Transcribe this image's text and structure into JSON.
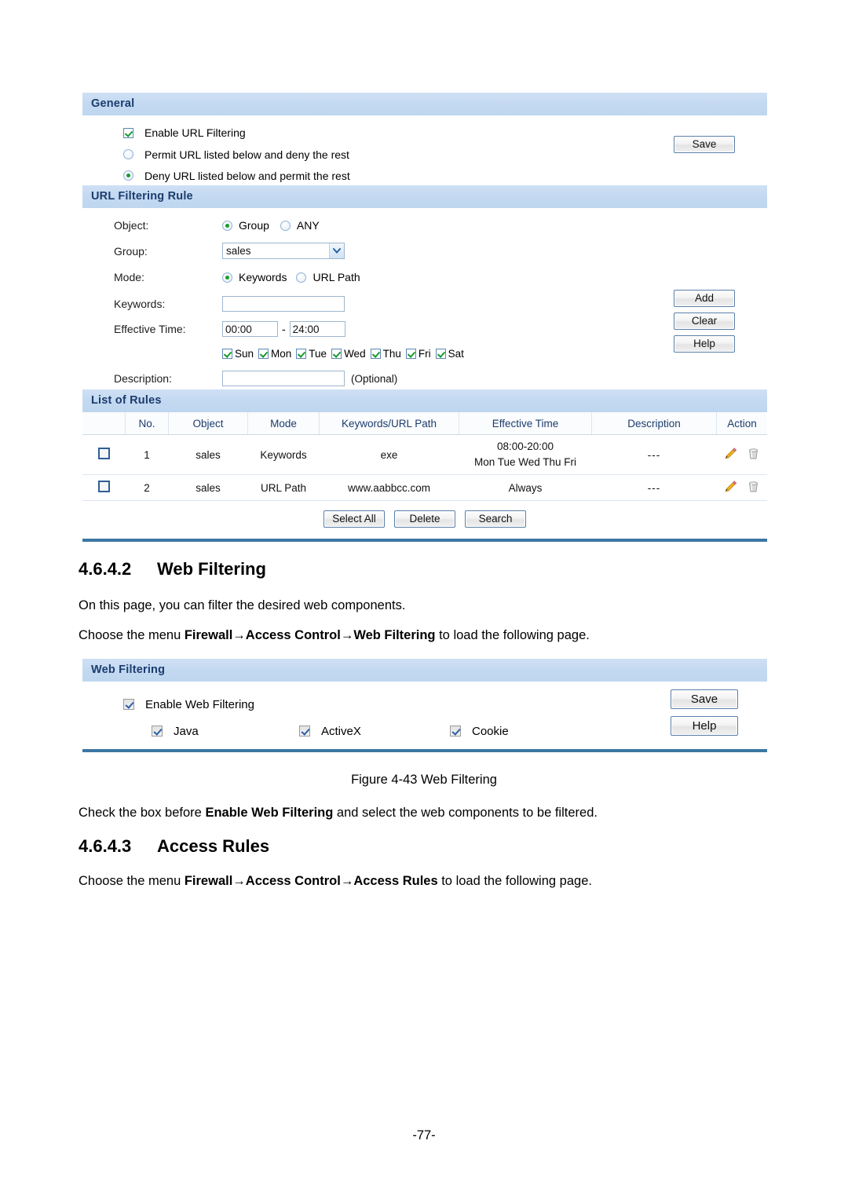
{
  "url_filtering": {
    "general": {
      "title": "General",
      "enable_label": "Enable URL Filtering",
      "enable_checked": true,
      "permit_label": "Permit URL listed below and deny the rest",
      "deny_label": "Deny URL listed below and permit the rest",
      "selected_policy": "deny",
      "save_label": "Save"
    },
    "rule": {
      "title": "URL Filtering Rule",
      "object_label": "Object:",
      "object_group_label": "Group",
      "object_any_label": "ANY",
      "object_selected": "Group",
      "group_label": "Group:",
      "group_value": "sales",
      "mode_label": "Mode:",
      "mode_keywords_label": "Keywords",
      "mode_urlpath_label": "URL Path",
      "mode_selected": "Keywords",
      "keywords_label": "Keywords:",
      "keywords_value": "",
      "effective_time_label": "Effective Time:",
      "time_start": "00:00",
      "time_sep": "-",
      "time_end": "24:00",
      "days": [
        {
          "name": "Sun",
          "checked": true
        },
        {
          "name": "Mon",
          "checked": true
        },
        {
          "name": "Tue",
          "checked": true
        },
        {
          "name": "Wed",
          "checked": true
        },
        {
          "name": "Thu",
          "checked": true
        },
        {
          "name": "Fri",
          "checked": true
        },
        {
          "name": "Sat",
          "checked": true
        }
      ],
      "description_label": "Description:",
      "description_value": "",
      "description_hint": "(Optional)",
      "add_label": "Add",
      "clear_label": "Clear",
      "help_label": "Help"
    },
    "list": {
      "title": "List of Rules",
      "columns": [
        "",
        "No.",
        "Object",
        "Mode",
        "Keywords/URL Path",
        "Effective Time",
        "Description",
        "Action"
      ],
      "rows": [
        {
          "selected": false,
          "no": "1",
          "object": "sales",
          "mode": "Keywords",
          "keywords": "exe",
          "effective_time_line1": "08:00-20:00",
          "effective_time_line2": "Mon Tue Wed Thu Fri",
          "description": "---",
          "edit_icon": "pencil-icon",
          "delete_icon": "trash-icon"
        },
        {
          "selected": false,
          "no": "2",
          "object": "sales",
          "mode": "URL Path",
          "keywords": "www.aabbcc.com",
          "effective_time_line1": "Always",
          "effective_time_line2": "",
          "description": "---",
          "edit_icon": "pencil-icon",
          "delete_icon": "trash-icon"
        }
      ],
      "select_all_label": "Select All",
      "delete_label": "Delete",
      "search_label": "Search"
    }
  },
  "section_web_filtering": {
    "number": "4.6.4.2",
    "title": "Web Filtering",
    "intro": "On this page, you can filter the desired web components.",
    "menu_line_prefix": "Choose the menu ",
    "menu_path": "Firewall→Access Control→Web Filtering",
    "menu_line_suffix": " to load the following page."
  },
  "web_filtering_panel": {
    "title": "Web Filtering",
    "enable_label": "Enable Web Filtering",
    "enable_checked": true,
    "components": [
      {
        "label": "Java",
        "checked": true
      },
      {
        "label": "ActiveX",
        "checked": true
      },
      {
        "label": "Cookie",
        "checked": true
      }
    ],
    "save_label": "Save",
    "help_label": "Help"
  },
  "figure_caption": "Figure 4-43 Web Filtering",
  "note_after_figure": {
    "prefix": "Check the box before ",
    "bold": "Enable Web Filtering",
    "suffix": " and select the web components to be filtered."
  },
  "section_access_rules": {
    "number": "4.6.4.3",
    "title": "Access Rules",
    "menu_line_prefix": "Choose the menu ",
    "menu_path": "Firewall→Access Control→Access Rules",
    "menu_line_suffix": " to load the following page."
  },
  "page_number": "-77-",
  "colors": {
    "panel_header_bg": "#c3d9f1",
    "panel_header_text": "#1b3c6e",
    "rule_line": "#3c77a3",
    "check_green": "#1a9a2e",
    "check_blue": "#2a5fa8",
    "table_header_text": "#1b3c6e"
  }
}
